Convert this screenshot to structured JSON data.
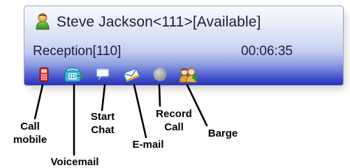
{
  "panel": {
    "title": "Steve Jackson<111>[Available]",
    "queue": "Reception[110]",
    "timer": "00:06:35"
  },
  "toolbar": {
    "buttons": [
      {
        "name": "call-mobile-button",
        "icon": "mobile-phone-icon"
      },
      {
        "name": "voicemail-button",
        "icon": "voicemail-phone-icon"
      },
      {
        "name": "start-chat-button",
        "icon": "chat-bubble-icon"
      },
      {
        "name": "email-button",
        "icon": "email-envelope-icon"
      },
      {
        "name": "record-call-button",
        "icon": "record-circle-icon"
      },
      {
        "name": "barge-button",
        "icon": "barge-users-icon"
      }
    ]
  },
  "callouts": {
    "call_mobile": "Call\nmobile",
    "voicemail": "Voicemail",
    "start_chat": "Start\nChat",
    "email": "E-mail",
    "record_call": "Record\nCall",
    "barge": "Barge"
  },
  "colors": {
    "panel_top": "#eef1fb",
    "panel_bottom": "#2632b7",
    "text": "#1c1c44"
  }
}
